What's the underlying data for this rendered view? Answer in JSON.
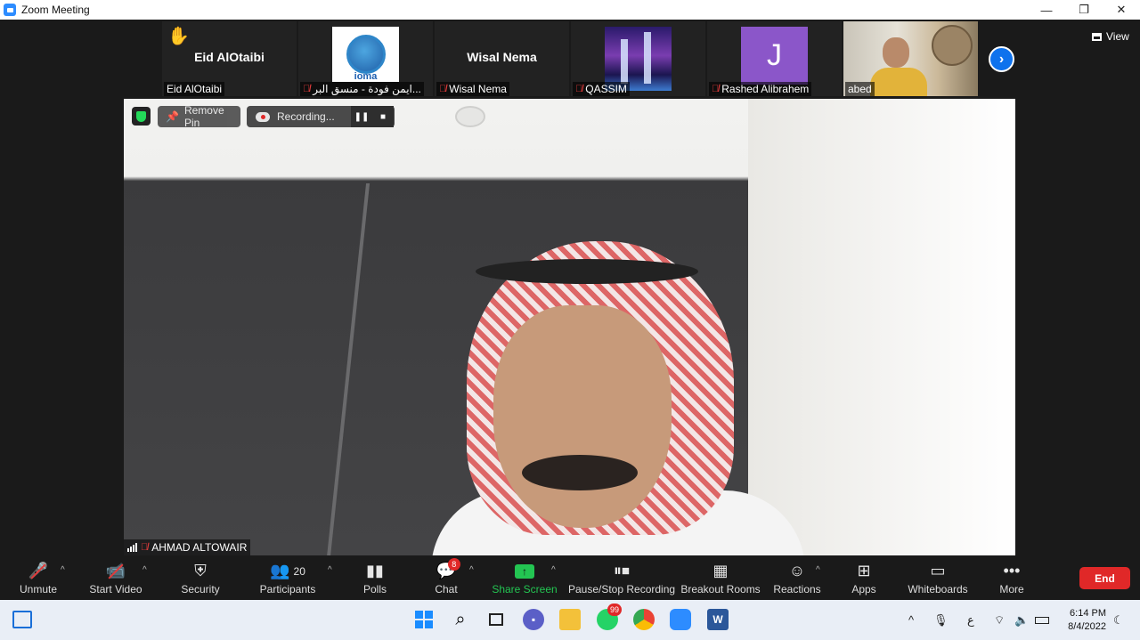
{
  "window": {
    "title": "Zoom Meeting",
    "minimize": "—",
    "maximize": "❐",
    "close": "✕"
  },
  "view_button": {
    "label": "View"
  },
  "participants_strip": [
    {
      "big_name": "Eid AlOtaibi",
      "caption": "Eid AlOtaibi",
      "muted": false,
      "hand_raised": true
    },
    {
      "big_name": "",
      "caption": "ايمن فودة - منسق البر...",
      "muted": true,
      "logo_text": "ioma"
    },
    {
      "big_name": "Wisal Nema",
      "caption": "Wisal Nema",
      "muted": true
    },
    {
      "big_name": "",
      "caption": "QASSIM",
      "muted": true
    },
    {
      "big_name": "",
      "caption": "Rashed Alibrahem",
      "muted": true,
      "avatar_letter": "J"
    },
    {
      "big_name": "",
      "caption": "abed",
      "muted": false
    }
  ],
  "main_video": {
    "remove_pin_label": "Remove Pin",
    "recording_label": "Recording...",
    "speaker_name": "AHMAD ALTOWAIR"
  },
  "toolbar": {
    "unmute": "Unmute",
    "start_video": "Start Video",
    "security": "Security",
    "participants": "Participants",
    "participants_count": "20",
    "polls": "Polls",
    "chat": "Chat",
    "chat_badge": "8",
    "share_screen": "Share Screen",
    "pause_stop_recording": "Pause/Stop Recording",
    "breakout_rooms": "Breakout Rooms",
    "reactions": "Reactions",
    "apps": "Apps",
    "whiteboards": "Whiteboards",
    "more": "More",
    "end": "End"
  },
  "taskbar": {
    "whatsapp_badge": "99",
    "keyboard_lang": "ع",
    "time": "6:14 PM",
    "date": "8/4/2022"
  },
  "colors": {
    "zoom_blue": "#0e72ed",
    "end_red": "#e02828",
    "share_green": "#23c552",
    "mute_red": "#e23b3b"
  }
}
